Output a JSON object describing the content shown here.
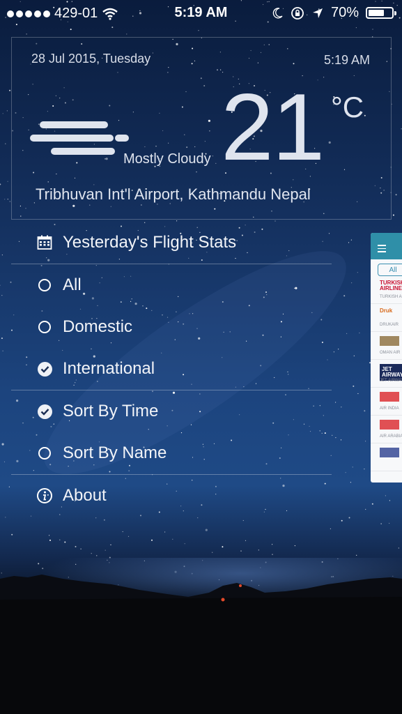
{
  "status_bar": {
    "carrier": "429-01",
    "time": "5:19 AM",
    "battery": "70%",
    "battery_level": 0.7,
    "icons": [
      "wifi-icon",
      "moon-icon",
      "rotation-lock-icon",
      "location-arrow-icon",
      "battery-icon"
    ]
  },
  "weather": {
    "date": "28 Jul 2015, Tuesday",
    "time": "5:19 AM",
    "condition": "Mostly Cloudy",
    "temperature": "21",
    "unit": "°C",
    "location": "Tribhuvan Int'l Airport, Kathmandu Nepal",
    "icon": "cloud-fog-icon"
  },
  "menu": {
    "header": {
      "label": "Yesterday's Flight Stats",
      "icon": "calendar-icon"
    },
    "filters": [
      {
        "label": "All",
        "selected": false
      },
      {
        "label": "Domestic",
        "selected": false
      },
      {
        "label": "International",
        "selected": true
      }
    ],
    "sorts": [
      {
        "label": "Sort By Time",
        "selected": true
      },
      {
        "label": "Sort By Name",
        "selected": false
      }
    ],
    "about": {
      "label": "About",
      "icon": "info-icon"
    }
  },
  "side_panel": {
    "pill": "All",
    "airlines": [
      {
        "logo": "TURKISH AIRLINES",
        "name": "TURKISH AI",
        "color": "#c8102e"
      },
      {
        "logo": "Druk",
        "name": "DRUKAIR",
        "color": "#d86a1c"
      },
      {
        "logo": "",
        "name": "OMAN AIR",
        "color": "#8a6b3a"
      },
      {
        "logo": "JET AIRWAYS",
        "name": "JET AIRWAY",
        "color": "#1b2a5a"
      },
      {
        "logo": "",
        "name": "AIR INDIA",
        "color": "#d9252a"
      },
      {
        "logo": "",
        "name": "AIR ARABIA",
        "color": "#d9252a"
      },
      {
        "logo": "",
        "name": "",
        "color": "#2a3f8f"
      }
    ]
  }
}
